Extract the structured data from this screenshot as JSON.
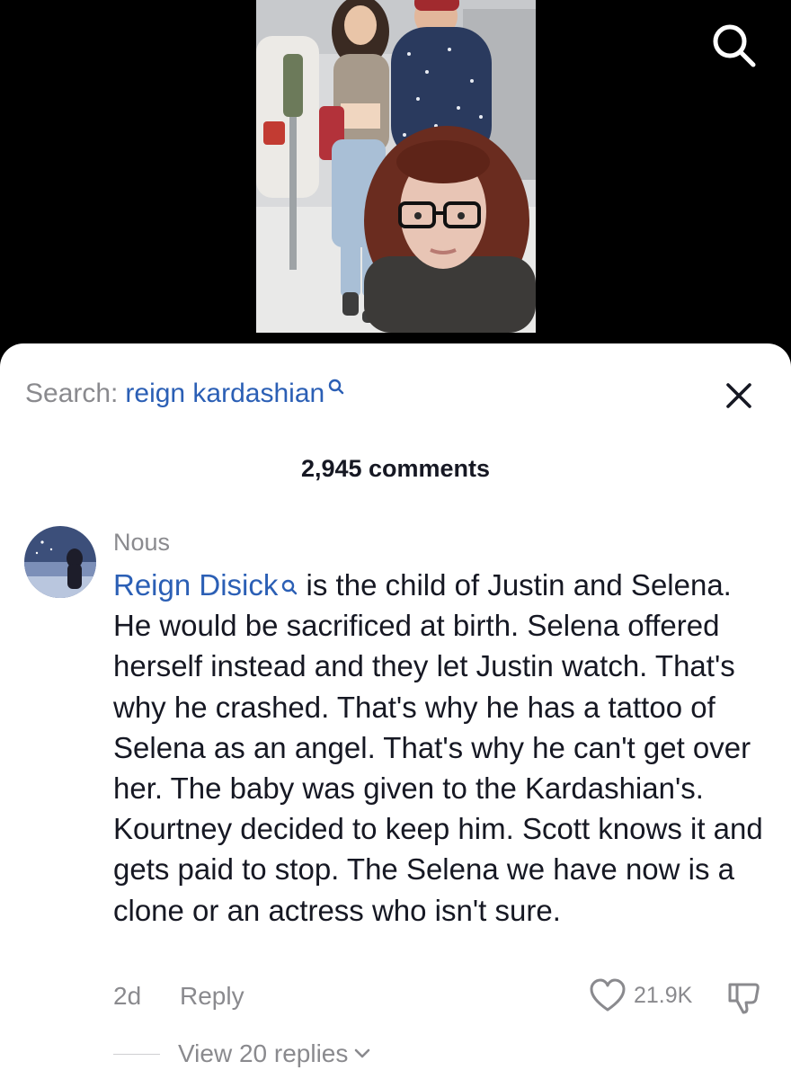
{
  "header": {
    "search_icon": "search-icon"
  },
  "video": {
    "thumbnail": "video-frame-with-creator-overlay"
  },
  "sheet": {
    "search_prefix": "Search:",
    "search_term": "reign kardashian",
    "close_icon": "close-icon",
    "comment_count": "2,945 comments"
  },
  "comment": {
    "author": "Nous",
    "mention": "Reign Disick",
    "text": " is the child of Justin and Selena. He would be sacrificed at birth. Selena offered herself instead and they let Justin watch. That's why he crashed. That's why he has a tattoo of Selena as an angel. That's why he can't get over her. The baby was given to the Kardashian's. Kourtney decided to keep him. Scott knows it and gets paid to stop. The Selena we have now is a clone or an actress who isn't sure.",
    "time": "2d",
    "reply_label": "Reply",
    "like_count": "21.9K",
    "view_replies": "View 20 replies"
  },
  "colors": {
    "link_blue": "#2b5fb5",
    "muted_gray": "#8a8a8e",
    "text": "#161823"
  }
}
